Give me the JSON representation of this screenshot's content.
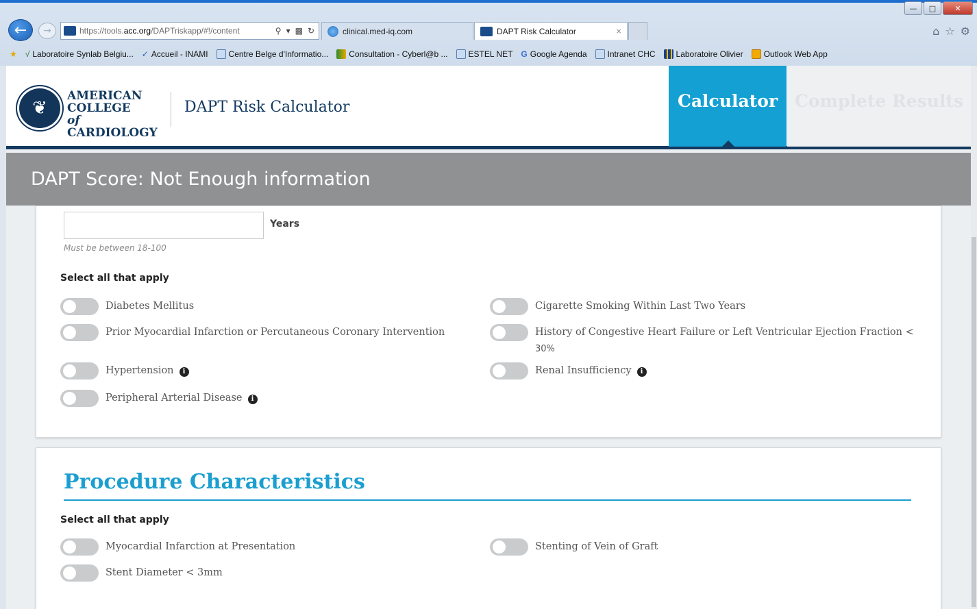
{
  "browser": {
    "url_prefix": "https://tools.",
    "url_host": "acc.org",
    "url_path": "/DAPTriskapp/#!/content",
    "tabs": [
      {
        "label": "clinical.med-iq.com"
      },
      {
        "label": "DAPT Risk Calculator"
      }
    ],
    "favorites": [
      "Laboratoire Synlab Belgiu...",
      "Accueil - INAMI",
      "Centre Belge d'Informatio...",
      "Consultation - Cyberl@b ...",
      "ESTEL NET",
      "Google Agenda",
      "Intranet CHC",
      "Laboratoire Olivier",
      "Outlook Web App"
    ]
  },
  "header": {
    "logo_lines": [
      "AMERICAN",
      "COLLEGE",
      "of",
      "CARDIOLOGY"
    ],
    "app_title": "DAPT Risk Calculator",
    "nav": {
      "calculator": "Calculator",
      "results": "Complete Results"
    }
  },
  "score": {
    "text": "DAPT Score: Not Enough information"
  },
  "patient": {
    "age_value": "",
    "age_unit": "Years",
    "age_hint": "Must be between 18-100",
    "select_label": "Select all that apply",
    "factors": {
      "diabetes": "Diabetes Mellitus",
      "prior_mi": "Prior Myocardial Infarction or Percutaneous Coronary Intervention",
      "hypertension": "Hypertension",
      "pad": "Peripheral Arterial Disease",
      "smoking": "Cigarette Smoking Within Last Two Years",
      "chf": "History of Congestive Heart Failure or Left Ventricular Ejection Fraction <",
      "chf_cont": "30%",
      "renal": "Renal Insufficiency"
    }
  },
  "procedure": {
    "title": "Procedure Characteristics",
    "select_label": "Select all that apply",
    "factors": {
      "mi_presentation": "Myocardial Infarction at Presentation",
      "stent_diameter": "Stent Diameter < 3mm",
      "vein_graft": "Stenting of Vein of Graft"
    }
  },
  "colors": {
    "accent": "#14a0d3",
    "navy": "#133a60",
    "score_bar": "#8f9193"
  }
}
